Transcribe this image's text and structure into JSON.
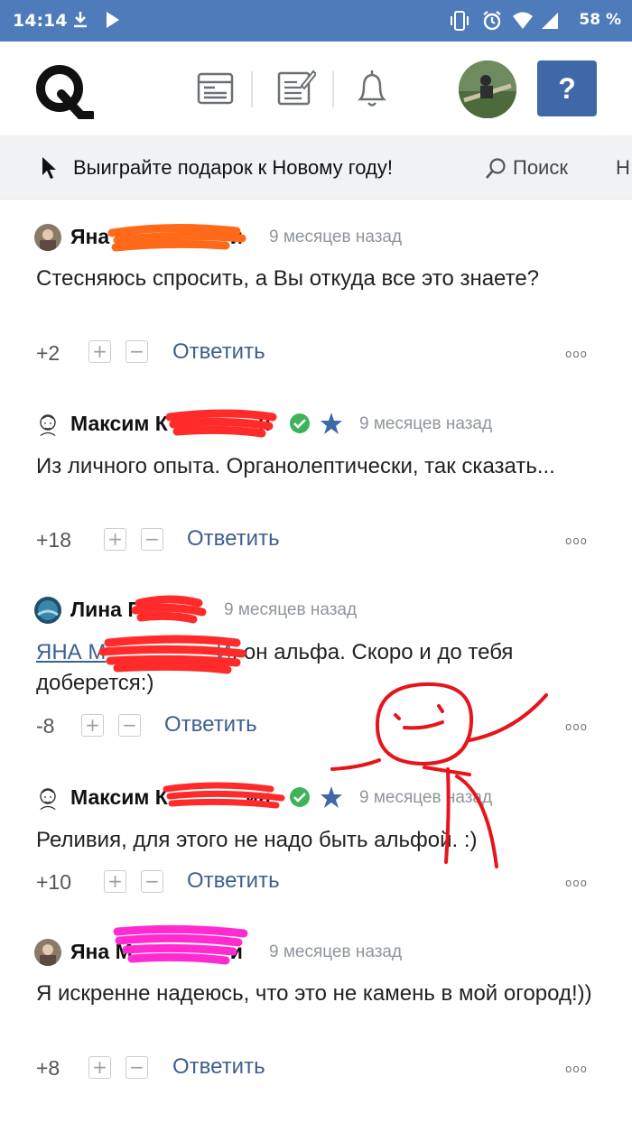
{
  "statusbar": {
    "time": "14:14",
    "battery": "58 %"
  },
  "header": {
    "ask_label": "?"
  },
  "subheader": {
    "promo": "Выиграйте подарок к Новому году!",
    "search": "Поиск",
    "extra": "Н"
  },
  "comments": [
    {
      "author": "Яна М",
      "author_suffix": "и",
      "time": "9 месяцев назад",
      "text": "Стесняюсь спросить, а Вы откуда все это знаете?",
      "score": "+2",
      "reply": "Ответить"
    },
    {
      "author": "Максим К",
      "author_suffix": "н",
      "time": "9 месяцев назад",
      "text": "Из личного опыта. Органолептически, так сказать...",
      "score": "+18",
      "reply": "Ответить"
    },
    {
      "author": "Лина Г",
      "author_suffix": "",
      "time": "9 месяцев назад",
      "mention": "ЯНА М",
      "mention_suffix": "И",
      "text_after": ", он альфа. Скоро и до тебя доберется:)",
      "score": "-8",
      "reply": "Ответить"
    },
    {
      "author": "Максим К",
      "author_suffix": "ин",
      "time": "9 месяцев назад",
      "text": "Реливия, для этого не надо быть альфой. :)",
      "score": "+10",
      "reply": "Ответить"
    },
    {
      "author": "Яна М",
      "author_suffix": "и",
      "time": "9 месяцев назад",
      "text": "Я искренне надеюсь, что это не камень в мой огород!))",
      "score": "+8",
      "reply": "Ответить"
    }
  ],
  "icons": {
    "plus": "+",
    "minus": "−",
    "more": "ooo"
  },
  "colors": {
    "statusbar": "#4e7bb9",
    "accent": "#3f68a8",
    "link": "#3f5f8f",
    "redaction_orange": "#ff6a1a",
    "redaction_red": "#ff2a2a",
    "redaction_pink": "#ff2bd1",
    "verified": "#3eb35c",
    "star": "#3f68a8"
  }
}
